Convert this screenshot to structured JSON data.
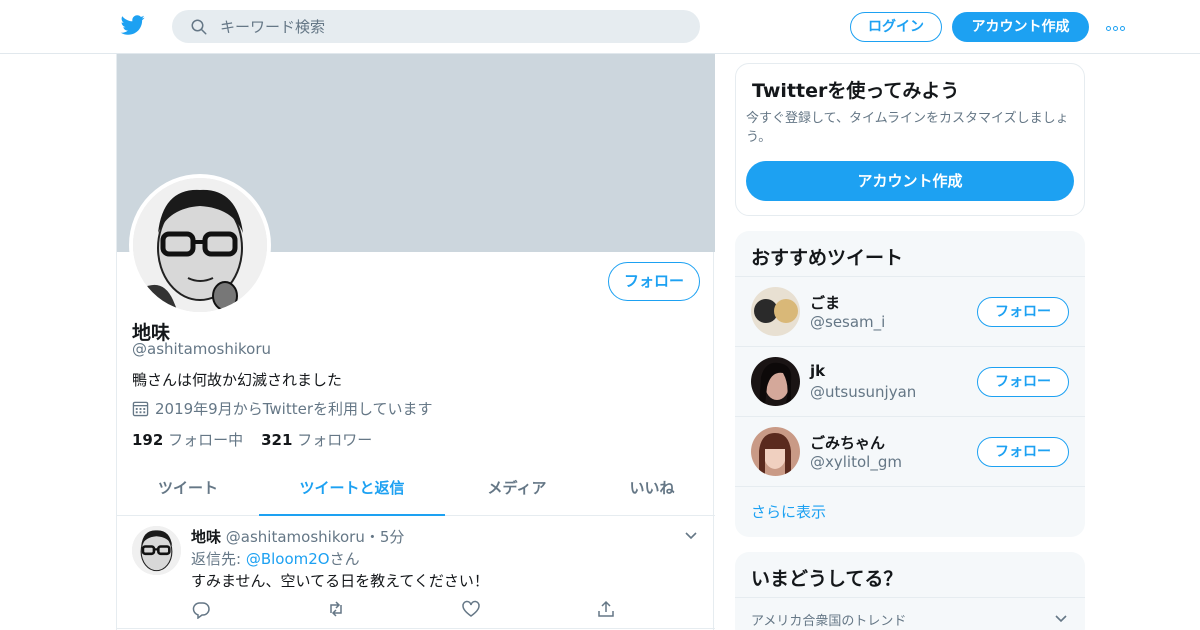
{
  "header": {
    "search_placeholder": "キーワード検索",
    "login_label": "ログイン",
    "signup_label": "アカウント作成"
  },
  "profile": {
    "display_name": "地味",
    "handle": "@ashitamoshikoru",
    "bio": "鴨さんは何故か幻滅されました",
    "joined": "2019年9月からTwitterを利用しています",
    "following_count": "192",
    "following_label": "フォロー中",
    "followers_count": "321",
    "followers_label": "フォロワー",
    "follow_label": "フォロー"
  },
  "tabs": [
    {
      "label": "ツイート",
      "active": false
    },
    {
      "label": "ツイートと返信",
      "active": true
    },
    {
      "label": "メディア",
      "active": false
    },
    {
      "label": "いいね",
      "active": false
    }
  ],
  "tweet": {
    "author": "地味",
    "handle": "@ashitamoshikoru",
    "separator": "・",
    "time": "5分",
    "reply_prefix": "返信先: ",
    "reply_mention": "@Bloom2O",
    "reply_suffix": "さん",
    "text": "すみません、空いてる日を教えてください！"
  },
  "signup_card": {
    "title": "Twitterを使ってみよう",
    "description": "今すぐ登録して、タイムラインをカスタマイズしましょう。",
    "button": "アカウント作成"
  },
  "recommendations": {
    "title": "おすすめツイート",
    "items": [
      {
        "name": "ごま",
        "handle": "@sesam_i",
        "follow": "フォロー"
      },
      {
        "name": "jk",
        "handle": "@utsusunjyan",
        "follow": "フォロー"
      },
      {
        "name": "ごみちゃん",
        "handle": "@xylitol_gm",
        "follow": "フォロー"
      }
    ],
    "show_more": "さらに表示"
  },
  "trends": {
    "title": "いまどうしてる？",
    "location": "アメリカ合衆国のトレンド"
  },
  "colors": {
    "accent": "#1da1f2",
    "banner": "#ccd6dd",
    "muted_text": "#657786",
    "panel_bg": "#f5f8fa"
  }
}
